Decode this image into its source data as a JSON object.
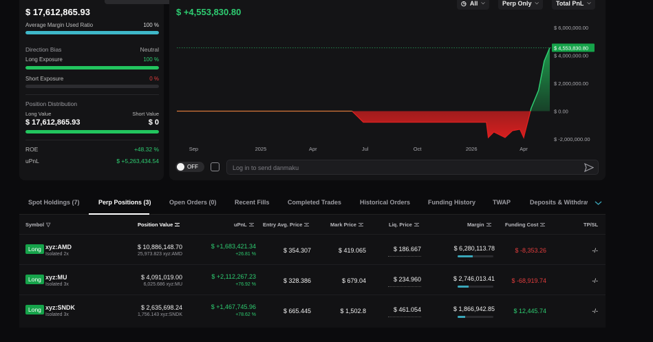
{
  "summary": {
    "total_value": "$ 17,612,865.93",
    "avg_margin_label": "Average Margin Used Ratio",
    "avg_margin_value": "100 %",
    "avg_margin_pct": 1.0,
    "direction_bias_label": "Direction Bias",
    "direction_bias_value": "Neutral",
    "long_exposure_label": "Long Exposure",
    "long_exposure_value": "100 %",
    "long_exposure_pct": 1.0,
    "short_exposure_label": "Short Exposure",
    "short_exposure_value": "0 %",
    "short_exposure_pct": 0.0,
    "position_dist_label": "Position Distribution",
    "long_value_label": "Long Value",
    "short_value_label": "Short Value",
    "long_value": "$ 17,612,865.93",
    "short_value": "$ 0",
    "roe_label": "ROE",
    "roe_value": "+48.32 %",
    "upnl_label": "uPnL",
    "upnl_value": "$ +5,263,434.54"
  },
  "chart": {
    "headline_value": "$ +4,553,830.80",
    "filter_all": "All",
    "filter_perp": "Perp Only",
    "filter_metric": "Total PnL",
    "current_label": "$ 4,553,830.80",
    "toggle_label": "OFF",
    "danmaku_placeholder": "Log in to send danmaku",
    "colors": {
      "positive": "#2ecc71",
      "negative": "#e02020",
      "flat": "#d97a3a"
    }
  },
  "chart_data": {
    "type": "area",
    "x_ticks": [
      "Sep",
      "2025",
      "Apr",
      "Jul",
      "Oct",
      "2026",
      "Apr"
    ],
    "y_ticks": [
      "$ 6,000,000.00",
      "$ 4,000,000.00",
      "$ 2,000,000.00",
      "$ 0.00",
      "$ -2,000,000.00"
    ],
    "y_tick_values": [
      6000000,
      4000000,
      2000000,
      0,
      -2000000
    ],
    "ylim": [
      -2400000,
      6600000
    ],
    "x": [
      0,
      0.12,
      0.25,
      0.37,
      0.47,
      0.485,
      0.5,
      0.56,
      0.65,
      0.75,
      0.8,
      0.83,
      0.835,
      0.85,
      0.88,
      0.9,
      0.92,
      0.93,
      0.95,
      0.97,
      0.985,
      1.0
    ],
    "values": [
      0,
      0,
      0,
      0,
      0,
      -400000,
      -800000,
      -800000,
      -800000,
      -800000,
      -800000,
      -800000,
      -1900000,
      -1500000,
      -1900000,
      -1400000,
      -1300000,
      -1900000,
      200000,
      1500000,
      3600000,
      4553830.8
    ]
  },
  "tabs": [
    "Spot Holdings (7)",
    "Perp Positions (3)",
    "Open Orders (0)",
    "Recent Fills",
    "Completed Trades",
    "Historical Orders",
    "Funding History",
    "TWAP",
    "Deposits & Withdraw"
  ],
  "table": {
    "headers": [
      "Symbol",
      "Position Value",
      "uPnL",
      "Entry Avg. Price",
      "Mark Price",
      "Liq. Price",
      "Margin",
      "Funding Cost",
      "TP/SL"
    ],
    "rows": [
      {
        "side": "Long",
        "symbol": "xyz:AMD",
        "mode": "Isolated 2x",
        "pos_value": "$ 10,886,148.70",
        "pos_qty": "25,973.823 xyz:AMD",
        "upnl": "$ +1,683,421.34",
        "upnl_pct": "+26.81 %",
        "entry": "$ 354.307",
        "mark": "$ 419.065",
        "liq": "$ 186.667",
        "margin": "$ 6,280,113.78",
        "margin_ratio": 0.42,
        "funding": "$ -8,353.26",
        "funding_sign": "neg",
        "tpsl": "-/-"
      },
      {
        "side": "Long",
        "symbol": "xyz:MU",
        "mode": "Isolated 3x",
        "pos_value": "$ 4,091,019.00",
        "pos_qty": "6,025.686 xyz:MU",
        "upnl": "$ +2,112,267.23",
        "upnl_pct": "+76.92 %",
        "entry": "$ 328.386",
        "mark": "$ 679.04",
        "liq": "$ 234.960",
        "margin": "$ 2,746,013.41",
        "margin_ratio": 0.3,
        "funding": "$ -68,919.74",
        "funding_sign": "neg",
        "tpsl": "-/-"
      },
      {
        "side": "Long",
        "symbol": "xyz:SNDK",
        "mode": "Isolated 3x",
        "pos_value": "$ 2,635,698.24",
        "pos_qty": "1,756.143 xyz:SNDK",
        "upnl": "$ +1,467,745.96",
        "upnl_pct": "+78.62 %",
        "entry": "$ 665.445",
        "mark": "$ 1,502.8",
        "liq": "$ 461.054",
        "margin": "$ 1,866,942.85",
        "margin_ratio": 0.22,
        "funding": "$ 12,445.74",
        "funding_sign": "pos",
        "tpsl": "-/-"
      }
    ]
  }
}
